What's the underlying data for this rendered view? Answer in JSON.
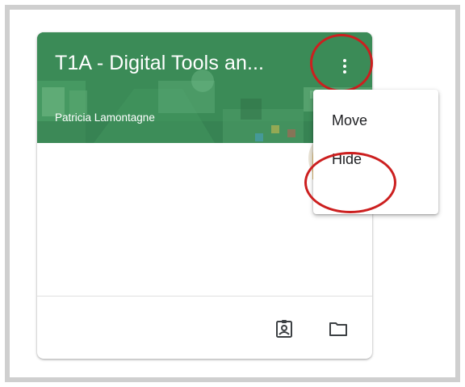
{
  "course_card": {
    "title": "T1A - Digital Tools an...",
    "teacher": "Patricia Lamontagne",
    "more_options_icon": "more-vert-icon",
    "footer_icons": [
      "assignment-ind-icon",
      "folder-icon"
    ]
  },
  "menu": {
    "items": [
      {
        "label": "Move"
      },
      {
        "label": "Hide"
      }
    ]
  },
  "colors": {
    "banner": "#3d8f5a",
    "highlight_ring": "#cc1f1f",
    "frame_border": "#cfcfcf"
  }
}
